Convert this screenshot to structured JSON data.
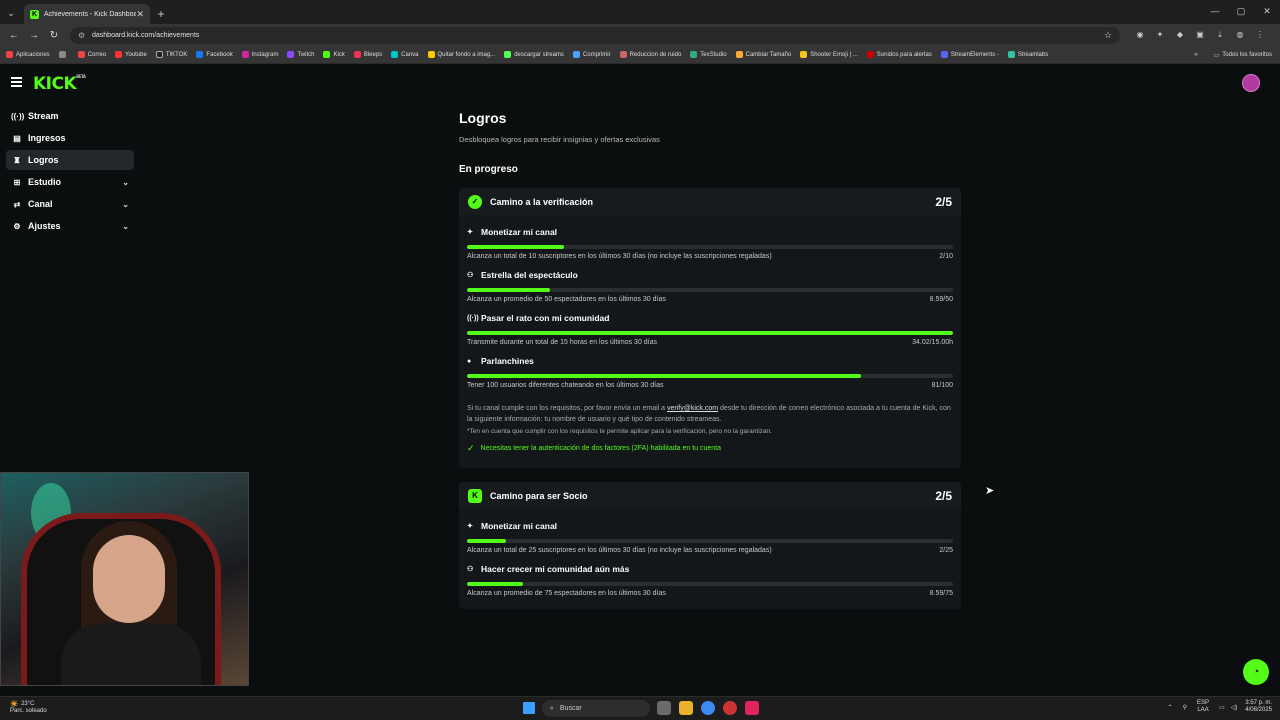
{
  "browser": {
    "tab_title": "Achievements - Kick Dashboard",
    "url": "dashboard.kick.com/achievements",
    "bookmarks": [
      "Aplicaciones",
      "Correo",
      "Youtube",
      "TIKTOK",
      "Facebook",
      "Instagram",
      "Twitch",
      "Kick",
      "Bleeps",
      "Canva",
      "Quitar fondo a imag...",
      "descargar streams",
      "Comprimir",
      "Reduccion de ruido",
      "TexStudio",
      "Cambiar Tamaño",
      "Shooter Emoji | ...",
      "Sonidos para alertas",
      "StreamElements -",
      "Streamlabs"
    ],
    "bookmarks_more": "»",
    "all_bookmarks": "Todos los favoritos"
  },
  "app": {
    "logo": "KICK",
    "logo_badge": "BETA"
  },
  "sidebar": {
    "items": [
      {
        "label": "Stream",
        "icon": "broadcast-icon"
      },
      {
        "label": "Ingresos",
        "icon": "wallet-icon"
      },
      {
        "label": "Logros",
        "icon": "trophy-icon"
      },
      {
        "label": "Estudio",
        "icon": "studio-icon"
      },
      {
        "label": "Canal",
        "icon": "channel-icon"
      },
      {
        "label": "Ajustes",
        "icon": "gear-icon"
      }
    ]
  },
  "main": {
    "title": "Logros",
    "subtitle": "Desbloquea logros para recibir insignias y ofertas exclusivas",
    "section": "En progreso",
    "cards": [
      {
        "title": "Camino a la verificación",
        "count": "2/5",
        "goals": [
          {
            "name": "Monetizar mi canal",
            "desc": "Alcanza un total de 10 suscriptores en los últimos 30 días (no incluye las suscripciones regaladas)",
            "value": "2/10",
            "progress": 0.2
          },
          {
            "name": "Estrella del espectáculo",
            "desc": "Alcanza un promedio de 50 espectadores en los últimos 30 días",
            "value": "8.59/50",
            "progress": 0.17
          },
          {
            "name": "Pasar el rato con mi comunidad",
            "desc": "Transmite durante un total de 15 horas en los últimos 30 días",
            "value": "34.02/15.00h",
            "progress": 1.0
          },
          {
            "name": "Parlanchines",
            "desc": "Tener 100 usuarios diferentes chateando en los últimos 30 días",
            "value": "81/100",
            "progress": 0.81
          }
        ],
        "note_pre": "Si tu canal cumple con los requisitos, por favor envía un email a ",
        "note_link": "verify@kick.com",
        "note_post": " desde tu dirección de correo electrónico asociada a tu cuenta de Kick, con la siguiente información: tu nombre de usuario y qué tipo de contenido streameas.",
        "note2": "*Ten en cuenta que cumplir con los requisitos te permite aplicar para la verificación, pero no la garantizan.",
        "requirement": "Necesitas tener la autenticación de dos factores (2FA) habilitada en tu cuenta"
      },
      {
        "title": "Camino para ser Socio",
        "count": "2/5",
        "goals": [
          {
            "name": "Monetizar mi canal",
            "desc": "Alcanza un total de 25 suscriptores en los últimos 30 días (no incluye las suscripciones regaladas)",
            "value": "2/25",
            "progress": 0.08
          },
          {
            "name": "Hacer crecer mi comunidad aún más",
            "desc": "Alcanza un promedio de 75 espectadores en los últimos 30 días",
            "value": "8.59/75",
            "progress": 0.115
          }
        ]
      }
    ]
  },
  "taskbar": {
    "weather_temp": "23°C",
    "weather_desc": "Parc. soleado",
    "search": "Buscar",
    "lang1": "ESP",
    "lang2": "LAA",
    "time": "3:57 p. m.",
    "date": "4/08/2025"
  },
  "colors": {
    "accent": "#53fc18",
    "background": "#0b0e0f",
    "card": "#141719"
  }
}
